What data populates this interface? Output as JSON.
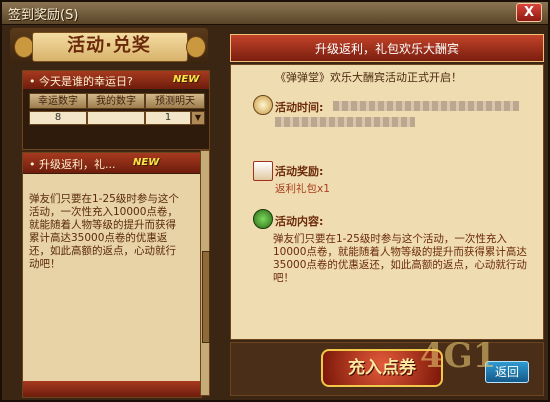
{
  "window": {
    "title": "签到奖励(S)",
    "close_label": "X"
  },
  "left": {
    "banner_title": "活动·兑奖",
    "lucky_section": {
      "title": "• 今天是谁的幸运日?",
      "badge": "NEW",
      "tabs": [
        "幸运数字",
        "我的数字",
        "预测明天"
      ],
      "lucky_number": "8",
      "my_number": "",
      "predict_value": "1"
    },
    "event_item": {
      "title": "• 升级返利，礼...",
      "badge": "NEW",
      "description": "弹友们只要在1-25级时参与这个活动，一次性充入10000点卷，就能随着人物等级的提升而获得累计高达35000点卷的优惠返还，如此高额的返点，心动就行动吧！"
    }
  },
  "right": {
    "header": "升级返利，礼包欢乐大酬宾",
    "intro": "《弹弹堂》欢乐大酬宾活动正式开启！",
    "time_label": "活动时间:",
    "reward_label": "活动奖励:",
    "reward_value": "返利礼包x1",
    "content_label": "活动内容:",
    "content": "弹友们只要在1-25级时参与这个活动，一次性充入10000点卷，就能随着人物等级的提升而获得累计高达35000点卷的优惠返还，如此高额的返点，心动就行动吧！",
    "charge_button": "充入点券",
    "back_button": "返回"
  },
  "watermark": "4G1",
  "colors": {
    "accent_red": "#a63a1e",
    "gold": "#f0c84a",
    "new_badge": "#ffe34a"
  }
}
